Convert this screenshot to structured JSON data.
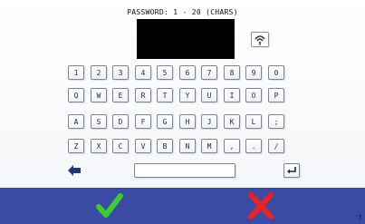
{
  "header": {
    "title": "PASSWORD: 1 - 20 (CHARS)"
  },
  "icons": {
    "reveal": "wifi-signal-icon",
    "backspace": "backspace-arrow-icon",
    "enter": "enter-return-icon",
    "confirm": "check-icon",
    "cancel": "cross-icon"
  },
  "keyboard": {
    "rows": [
      [
        "1",
        "2",
        "3",
        "4",
        "5",
        "6",
        "7",
        "8",
        "9",
        "0"
      ],
      [
        "Q",
        "W",
        "E",
        "R",
        "T",
        "Y",
        "U",
        "I",
        "O",
        "P"
      ],
      [
        "A",
        "S",
        "D",
        "F",
        "G",
        "H",
        "J",
        "K",
        "L",
        ";"
      ],
      [
        "Z",
        "X",
        "C",
        "V",
        "B",
        "N",
        "M",
        ",",
        ".",
        "/"
      ]
    ]
  },
  "colors": {
    "bottom_bar": "#3b4ba3",
    "confirm": "#3ecb2f",
    "cancel": "#ec2220",
    "key_border": "#7c8596"
  },
  "footer": {
    "corner_text": "7"
  }
}
